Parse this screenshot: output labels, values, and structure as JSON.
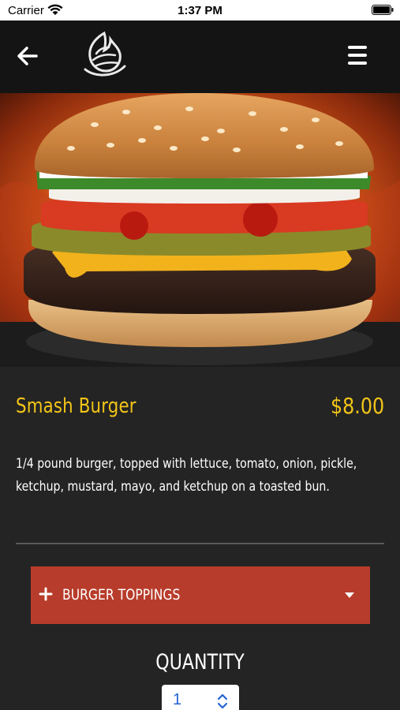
{
  "status_bar": {
    "carrier": "Carrier",
    "time": "1:37 PM"
  },
  "header": {
    "back_icon": "arrow-left-icon",
    "logo_icon": "flame-logo-icon",
    "menu_icon": "hamburger-menu-icon"
  },
  "hero": {
    "image": "burger-photo"
  },
  "product": {
    "name": "Smash Burger",
    "price": "$8.00",
    "description": "1/4 pound burger, topped with lettuce, tomato, onion, pickle, ketchup, mustard, mayo, and ketchup on a toasted bun."
  },
  "toppings": {
    "label": "BURGER TOPPINGS"
  },
  "quantity": {
    "label": "QUANTITY",
    "value": "1"
  },
  "colors": {
    "accent_yellow": "#f2c418",
    "toppings_red": "#b83c2b",
    "background": "#242424",
    "header": "#141414"
  }
}
